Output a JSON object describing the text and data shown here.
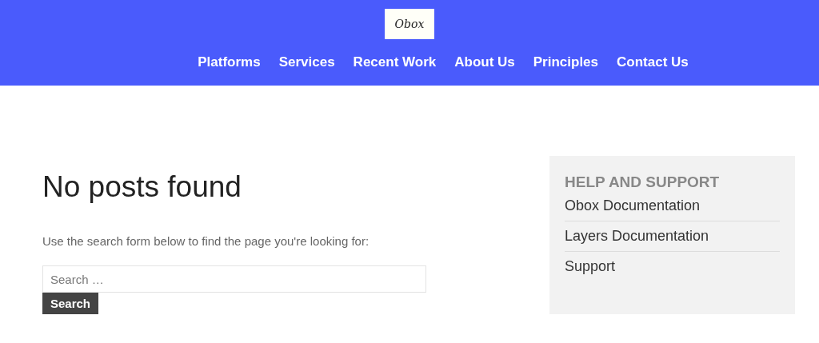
{
  "header": {
    "logo": "Obox",
    "nav": [
      "Platforms",
      "Services",
      "Recent Work",
      "About Us",
      "Principles",
      "Contact Us"
    ]
  },
  "main": {
    "title": "No posts found",
    "message": "Use the search form below to find the page you're looking for:",
    "search": {
      "placeholder": "Search …",
      "button": "Search"
    }
  },
  "sidebar": {
    "title": "HELP AND SUPPORT",
    "links": [
      "Obox Documentation",
      "Layers Documentation",
      "Support"
    ]
  }
}
